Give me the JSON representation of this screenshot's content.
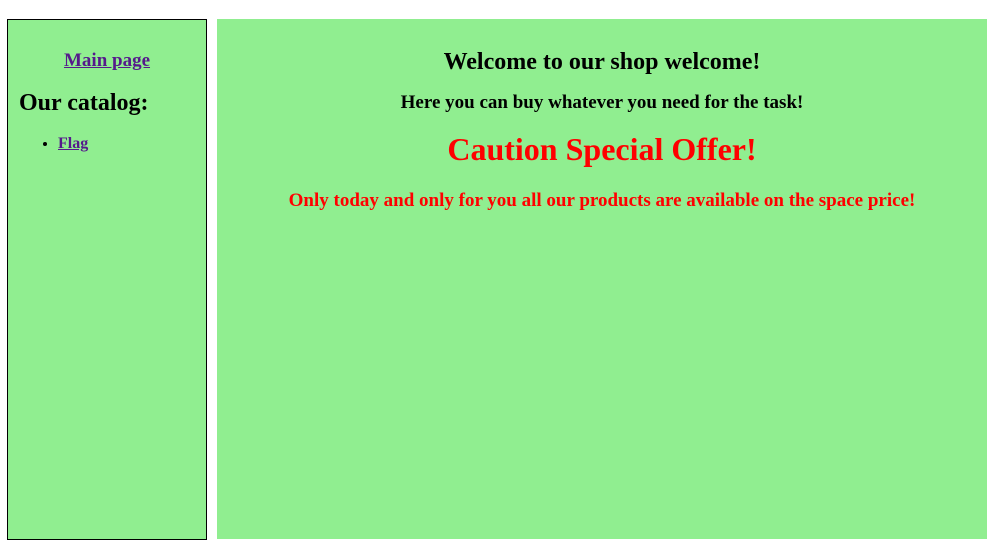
{
  "sidebar": {
    "main_link": "Main page",
    "catalog_title": "Our catalog:",
    "items": [
      {
        "label": "Flag"
      }
    ]
  },
  "content": {
    "welcome": "Welcome to our shop welcome!",
    "subtitle": "Here you can buy whatever you need for the task!",
    "offer_title": "Caution Special Offer!",
    "offer_text": "Only today and only for you all our products are available on the space price!"
  },
  "colors": {
    "background": "#90ee90",
    "link": "#551a8b",
    "offer": "#ff0000"
  }
}
